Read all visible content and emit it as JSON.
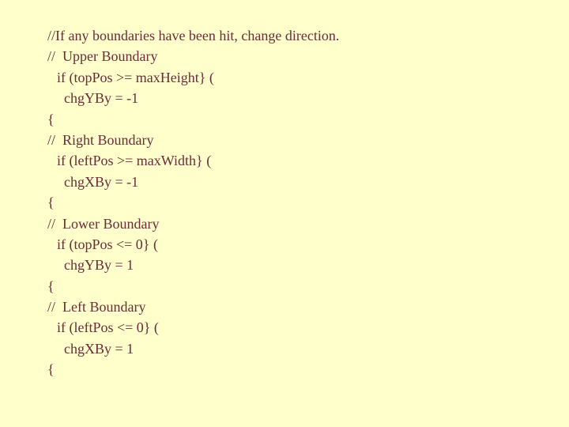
{
  "slide": {
    "lines": [
      {
        "text": "//If any boundaries have been hit, change direction.",
        "indent": 0,
        "kind": "comment"
      },
      {
        "text": "//  Upper Boundary",
        "indent": 0,
        "kind": "comment"
      },
      {
        "text": "if (topPos >= maxHeight} (",
        "indent": 1,
        "kind": "code"
      },
      {
        "text": "chgYBy = -1",
        "indent": 2,
        "kind": "code"
      },
      {
        "text": "{",
        "indent": 0,
        "kind": "brace"
      },
      {
        "text": "//  Right Boundary",
        "indent": 0,
        "kind": "comment"
      },
      {
        "text": "if (leftPos >= maxWidth} (",
        "indent": 1,
        "kind": "code"
      },
      {
        "text": "chgXBy = -1",
        "indent": 2,
        "kind": "code"
      },
      {
        "text": "{",
        "indent": 0,
        "kind": "brace"
      },
      {
        "text": "//  Lower Boundary",
        "indent": 0,
        "kind": "comment"
      },
      {
        "text": "if (topPos <= 0} (",
        "indent": 1,
        "kind": "code"
      },
      {
        "text": "chgYBy = 1",
        "indent": 2,
        "kind": "code"
      },
      {
        "text": "{",
        "indent": 0,
        "kind": "brace"
      },
      {
        "text": "//  Left Boundary",
        "indent": 0,
        "kind": "comment"
      },
      {
        "text": "if (leftPos <= 0} (",
        "indent": 1,
        "kind": "code"
      },
      {
        "text": "chgXBy = 1",
        "indent": 2,
        "kind": "code"
      },
      {
        "text": "{",
        "indent": 0,
        "kind": "brace"
      }
    ]
  },
  "colors": {
    "background": "#FFFFCC",
    "text": "#6B2B3A"
  }
}
